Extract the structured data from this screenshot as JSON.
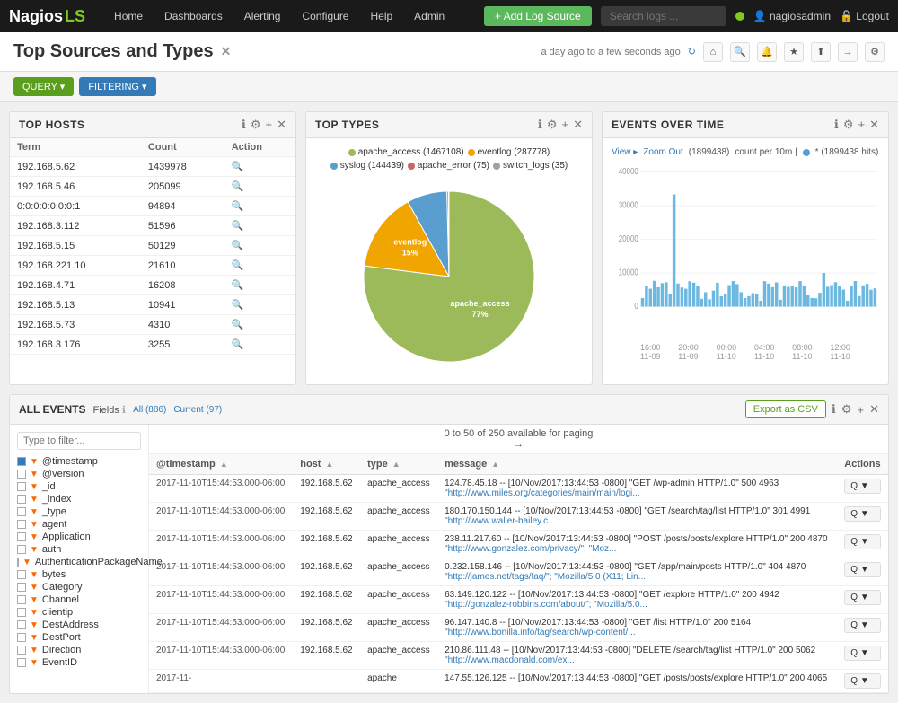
{
  "nav": {
    "logo_nagios": "Nagios",
    "logo_ls": "LS",
    "links": [
      "Home",
      "Dashboards",
      "Alerting",
      "Configure",
      "Help",
      "Admin"
    ],
    "add_btn": "+ Add Log Source",
    "search_placeholder": "Search logs ...",
    "user": "nagiosadmin",
    "logout": "Logout"
  },
  "page": {
    "title": "Top Sources and Types",
    "time_range": "a day ago to a few seconds ago",
    "toolbar_query": "QUERY ▾",
    "toolbar_filtering": "FILTERING ▾"
  },
  "top_hosts": {
    "panel_title": "TOP HOSTS",
    "columns": [
      "Term",
      "Count",
      "Action"
    ],
    "rows": [
      {
        "term": "192.168.5.62",
        "count": "1439978"
      },
      {
        "term": "192.168.5.46",
        "count": "205099"
      },
      {
        "term": "0:0:0:0:0:0:0:1",
        "count": "94894"
      },
      {
        "term": "192.168.3.112",
        "count": "51596"
      },
      {
        "term": "192.168.5.15",
        "count": "50129"
      },
      {
        "term": "192.168.221.10",
        "count": "21610"
      },
      {
        "term": "192.168.4.71",
        "count": "16208"
      },
      {
        "term": "192.168.5.13",
        "count": "10941"
      },
      {
        "term": "192.168.5.73",
        "count": "4310"
      },
      {
        "term": "192.168.3.176",
        "count": "3255"
      }
    ]
  },
  "top_types": {
    "panel_title": "TOP TYPES",
    "legend": [
      {
        "label": "apache_access (1467108)",
        "color": "#9cba5a"
      },
      {
        "label": "eventlog (287778)",
        "color": "#f0a500"
      },
      {
        "label": "syslog (144439)",
        "color": "#5a9ecf"
      },
      {
        "label": "apache_error (75)",
        "color": "#cc6666"
      },
      {
        "label": "switch_logs (35)",
        "color": "#a0a0a0"
      }
    ],
    "slices": [
      {
        "label": "eventlog",
        "pct": "15%",
        "color": "#f0a500",
        "startAngle": 0,
        "sweep": 54
      },
      {
        "label": "apache_access",
        "pct": "77%",
        "color": "#9cba5a",
        "startAngle": 54,
        "sweep": 277
      },
      {
        "label": "syslog",
        "pct": "8%",
        "color": "#5a9ecf",
        "startAngle": 331,
        "sweep": 29
      }
    ]
  },
  "events_over_time": {
    "panel_title": "EVENTS OVER TIME",
    "view_label": "View ▸",
    "zoom_out": "Zoom Out",
    "total": "(1899438)",
    "count_per": "count per 10m |",
    "dot_label": "* (1899438 hits)",
    "y_labels": [
      "40000",
      "30000",
      "20000",
      "10000",
      "0"
    ],
    "x_labels": [
      "16:00\n11-09",
      "20:00\n11-09",
      "00:00\n11-10",
      "04:00\n11-10",
      "08:00\n11-10",
      "12:00\n11-10"
    ]
  },
  "all_events": {
    "panel_title": "ALL EVENTS",
    "fields_label": "Fields",
    "all_count": "All (886)",
    "current_count": "Current (97)",
    "filter_placeholder": "Type to filter...",
    "paging": "0 to 50 of 250 available for paging",
    "export_label": "Export as CSV",
    "fields": [
      {
        "name": "@timestamp",
        "checked": true
      },
      {
        "name": "@version",
        "checked": false
      },
      {
        "name": "_id",
        "checked": false
      },
      {
        "name": "_index",
        "checked": false
      },
      {
        "name": "_type",
        "checked": false
      },
      {
        "name": "agent",
        "checked": false
      },
      {
        "name": "Application",
        "checked": false
      },
      {
        "name": "auth",
        "checked": false
      },
      {
        "name": "AuthenticationPackageName",
        "checked": false
      },
      {
        "name": "bytes",
        "checked": false
      },
      {
        "name": "Category",
        "checked": false
      },
      {
        "name": "Channel",
        "checked": false
      },
      {
        "name": "clientip",
        "checked": false
      },
      {
        "name": "DestAddress",
        "checked": false
      },
      {
        "name": "DestPort",
        "checked": false
      },
      {
        "name": "Direction",
        "checked": false
      },
      {
        "name": "EventID",
        "checked": false
      }
    ],
    "columns": [
      "@timestamp",
      "host",
      "type",
      "message",
      "Actions"
    ],
    "rows": [
      {
        "timestamp": "2017-11-10T15:44:53.000-06:00",
        "host": "192.168.5.62",
        "type": "apache_access",
        "message": "124.78.45.18 -- [10/Nov/2017:13:44:53 -0800] \"GET /wp-admin HTTP/1.0\" 500 4963",
        "message_link": "\"http://www.miles.org/categories/main/main/logi..."
      },
      {
        "timestamp": "2017-11-10T15:44:53.000-06:00",
        "host": "192.168.5.62",
        "type": "apache_access",
        "message": "180.170.150.144 -- [10/Nov/2017:13:44:53 -0800] \"GET /search/tag/list HTTP/1.0\" 301 4991",
        "message_link": "\"http://www.waller-bailey.c..."
      },
      {
        "timestamp": "2017-11-10T15:44:53.000-06:00",
        "host": "192.168.5.62",
        "type": "apache_access",
        "message": "238.11.217.60 -- [10/Nov/2017:13:44:53 -0800] \"POST /posts/posts/explore HTTP/1.0\" 200 4870",
        "message_link": "\"http://www.gonzalez.com/privacy/\"; \"Moz..."
      },
      {
        "timestamp": "2017-11-10T15:44:53.000-06:00",
        "host": "192.168.5.62",
        "type": "apache_access",
        "message": "0.232.158.146 -- [10/Nov/2017:13:44:53 -0800] \"GET /app/main/posts HTTP/1.0\" 404 4870",
        "message_link": "\"http://james.net/tags/faq/\"; \"Mozilla/5.0 (X11; Lin..."
      },
      {
        "timestamp": "2017-11-10T15:44:53.000-06:00",
        "host": "192.168.5.62",
        "type": "apache_access",
        "message": "63.149.120.122 -- [10/Nov/2017:13:44:53 -0800] \"GET /explore HTTP/1.0\" 200 4942",
        "message_link": "\"http://gonzalez-robbins.com/about/\"; \"Mozilla/5.0..."
      },
      {
        "timestamp": "2017-11-10T15:44:53.000-06:00",
        "host": "192.168.5.62",
        "type": "apache_access",
        "message": "96.147.140.8 -- [10/Nov/2017:13:44:53 -0800] \"GET /list HTTP/1.0\" 200 5164",
        "message_link": "\"http://www.bonilla.info/tag/search/wp-content/..."
      },
      {
        "timestamp": "2017-11-10T15:44:53.000-06:00",
        "host": "192.168.5.62",
        "type": "apache_access",
        "message": "210.86.111.48 -- [10/Nov/2017:13:44:53 -0800] \"DELETE /search/tag/list HTTP/1.0\" 200 5062",
        "message_link": "\"http://www.macdonald.com/ex..."
      },
      {
        "timestamp": "2017-11-",
        "host": "",
        "type": "apache",
        "message": "147.55.126.125 -- [10/Nov/2017:13:44:53 -0800] \"GET /posts/posts/explore HTTP/1.0\" 200 4065",
        "message_link": ""
      }
    ]
  }
}
